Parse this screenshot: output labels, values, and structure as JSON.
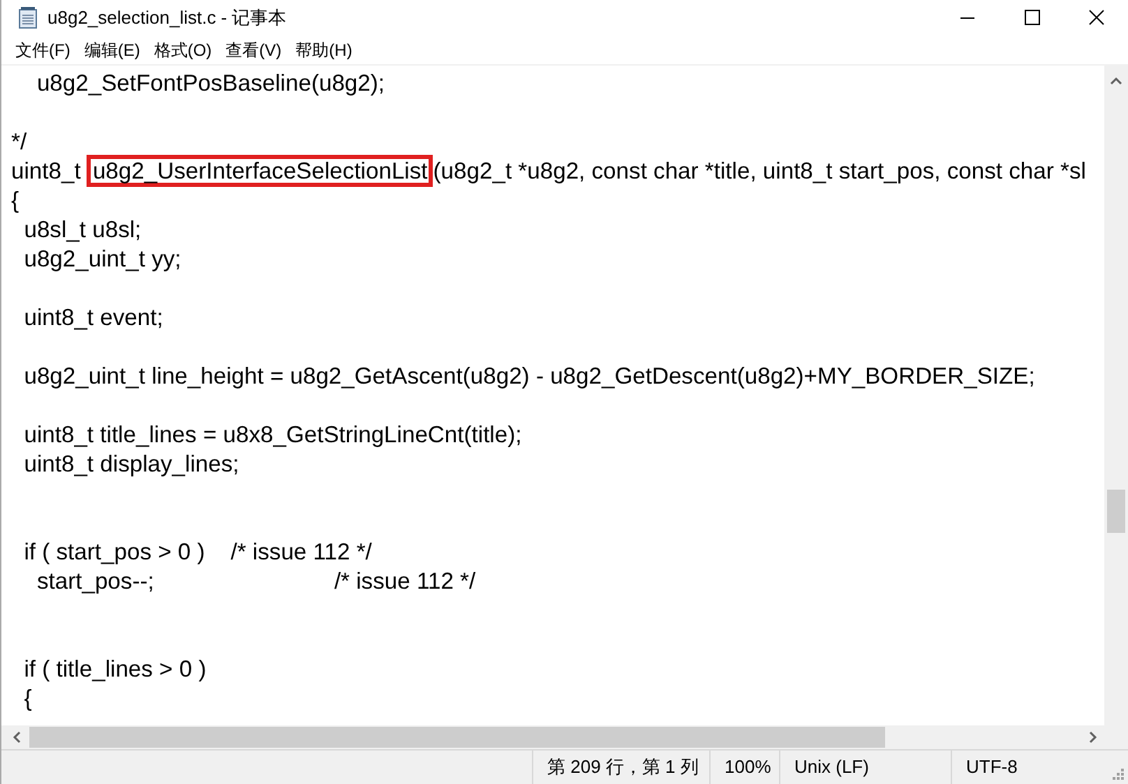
{
  "window": {
    "title": "u8g2_selection_list.c - 记事本"
  },
  "menu": [
    "文件(F)",
    "编辑(E)",
    "格式(O)",
    "查看(V)",
    "帮助(H)"
  ],
  "lines": [
    {
      "kind": "plain",
      "text": "    u8g2_SetFontPosBaseline(u8g2);"
    },
    {
      "kind": "blank"
    },
    {
      "kind": "plain",
      "text": "*/"
    },
    {
      "kind": "highlighted",
      "before": "uint8_t ",
      "highlight": "u8g2_UserInterfaceSelectionList",
      "after": "(u8g2_t *u8g2, const char *title, uint8_t start_pos, const char *sl"
    },
    {
      "kind": "plain",
      "text": "{"
    },
    {
      "kind": "plain",
      "text": "  u8sl_t u8sl;"
    },
    {
      "kind": "plain",
      "text": "  u8g2_uint_t yy;"
    },
    {
      "kind": "blank"
    },
    {
      "kind": "plain",
      "text": "  uint8_t event;"
    },
    {
      "kind": "blank"
    },
    {
      "kind": "plain",
      "text": "  u8g2_uint_t line_height = u8g2_GetAscent(u8g2) - u8g2_GetDescent(u8g2)+MY_BORDER_SIZE;"
    },
    {
      "kind": "blank"
    },
    {
      "kind": "plain",
      "text": "  uint8_t title_lines = u8x8_GetStringLineCnt(title);"
    },
    {
      "kind": "plain",
      "text": "  uint8_t display_lines;"
    },
    {
      "kind": "blank"
    },
    {
      "kind": "blank"
    },
    {
      "kind": "plain",
      "text": "  if ( start_pos > 0 )    /* issue 112 */"
    },
    {
      "kind": "plain",
      "text": "    start_pos--;                            /* issue 112 */"
    },
    {
      "kind": "blank"
    },
    {
      "kind": "blank"
    },
    {
      "kind": "plain",
      "text": "  if ( title_lines > 0 )"
    },
    {
      "kind": "plain",
      "text": "  {"
    }
  ],
  "status_bar": [
    "第 209 行，第 1 列",
    "100%",
    "Unix (LF)",
    "UTF-8"
  ]
}
